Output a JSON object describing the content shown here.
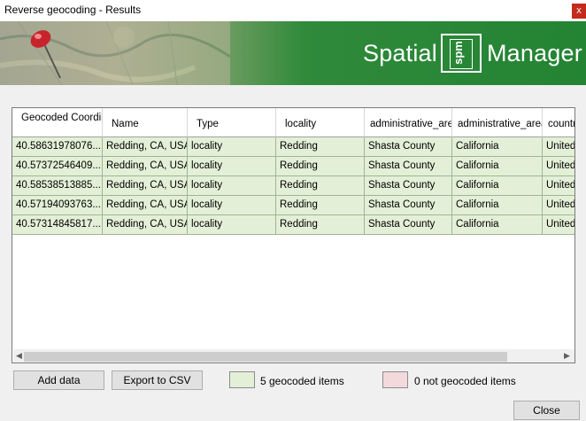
{
  "window": {
    "title": "Reverse geocoding - Results",
    "close_glyph": "x"
  },
  "banner": {
    "logo_left": "Spatial",
    "logo_mark": "spm",
    "logo_right": "Manager"
  },
  "table": {
    "columns": [
      "Geocoded Coordinates",
      "Name",
      "Type",
      "locality",
      "administrative_area",
      "administrative_area",
      "countr"
    ],
    "rows": [
      [
        "40.58631978076...",
        "Redding, CA, USA",
        "locality",
        "Redding",
        "Shasta County",
        "California",
        "United"
      ],
      [
        "40.57372546409...",
        "Redding, CA, USA",
        "locality",
        "Redding",
        "Shasta County",
        "California",
        "United"
      ],
      [
        "40.58538513885...",
        "Redding, CA, USA",
        "locality",
        "Redding",
        "Shasta County",
        "California",
        "United"
      ],
      [
        "40.57194093763...",
        "Redding, CA, USA",
        "locality",
        "Redding",
        "Shasta County",
        "California",
        "United"
      ],
      [
        "40.57314845817...",
        "Redding, CA, USA",
        "locality",
        "Redding",
        "Shasta County",
        "California",
        "United"
      ]
    ],
    "row_color": "#e3f0d7"
  },
  "buttons": {
    "add_data": "Add data",
    "export_csv": "Export to CSV",
    "close": "Close"
  },
  "legend": {
    "geocoded_label": "5 geocoded items",
    "geocoded_color": "#e3f0d7",
    "not_geocoded_label": "0 not geocoded items",
    "not_geocoded_color": "#f3d9dc"
  },
  "colors": {
    "banner_green": "#238433"
  }
}
